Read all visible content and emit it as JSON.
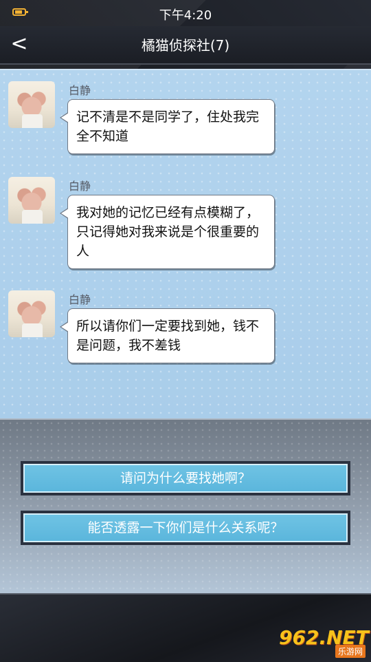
{
  "status_bar": {
    "time": "下午4:20",
    "battery_icon": "battery-icon"
  },
  "header": {
    "back_icon": "<",
    "title": "橘猫侦探社(7)"
  },
  "messages": [
    {
      "sender": "白静",
      "text": "记不清是不是同学了，住处我完全不知道"
    },
    {
      "sender": "白静",
      "text": "我对她的记忆已经有点模糊了，只记得她对我来说是个很重要的人"
    },
    {
      "sender": "白静",
      "text": "所以请你们一定要找到她，钱不是问题，我不差钱"
    }
  ],
  "options": [
    {
      "label": "请问为什么要找她啊？"
    },
    {
      "label": "能否透露一下你们是什么关系呢？"
    }
  ],
  "watermark": {
    "logo": "962.NET",
    "sub": "乐游网"
  },
  "colors": {
    "chat_bg": "#b3d4ee",
    "option_fill": "#6fc3e4",
    "header_bg": "#262a33"
  }
}
